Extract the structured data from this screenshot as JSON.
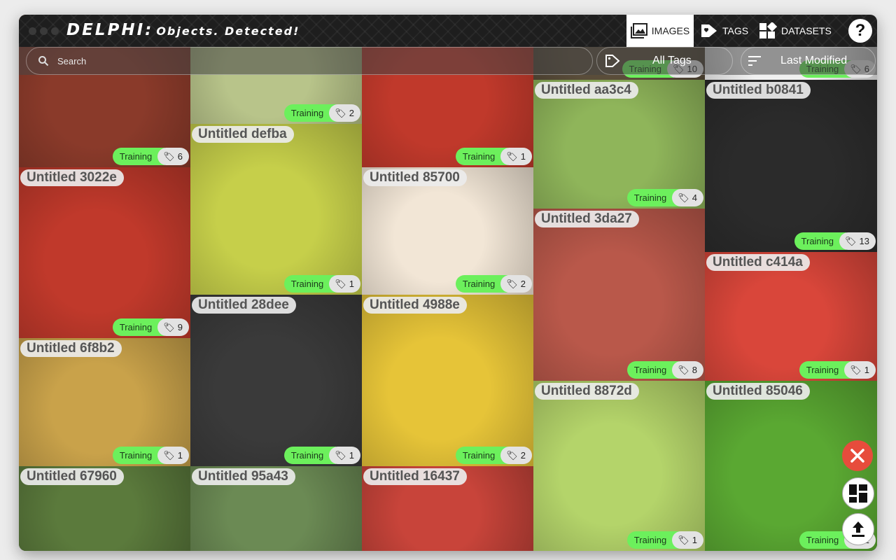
{
  "app": {
    "title_main": "DELPHI:",
    "title_tag": "Objects. Detected!"
  },
  "nav": {
    "images_label": "IMAGES",
    "tags_label": "TAGS",
    "datasets_label": "DATASETS",
    "help_label": "?"
  },
  "toolbar": {
    "search_placeholder": "Search",
    "tag_filter": "All Tags",
    "sort": "Last Modified"
  },
  "icons": {
    "search": "search-icon",
    "tag_filter": "tag-icon",
    "sort": "sort-icon",
    "images_nav": "image-icon",
    "tags_nav": "tag-icon",
    "datasets_nav": "datasets-icon",
    "close_fab": "close-icon",
    "layout_fab": "layout-icon",
    "upload_fab": "upload-icon"
  },
  "colors": {
    "accent_training": "#6cf05c",
    "close_fab": "#e74c3c",
    "header": "#1e1e1e"
  },
  "tiles": [
    {
      "title": "",
      "label": "Training",
      "count": "6",
      "bg": "#8a3a2a"
    },
    {
      "title": "",
      "label": "Training",
      "count": "2",
      "bg": "#b8c48a"
    },
    {
      "title": "",
      "label": "Training",
      "count": "1",
      "bg": "#c0392b"
    },
    {
      "title": "",
      "label": "Training",
      "count": "10",
      "bg": "#5a4d3a"
    },
    {
      "title": "",
      "label": "Training",
      "count": "6",
      "bg": "#f0f0f0"
    },
    {
      "title": "Untitled defba",
      "label": "Training",
      "count": "1",
      "bg": "#c6cf4a"
    },
    {
      "title": "Untitled 3022e",
      "label": "Training",
      "count": "9",
      "bg": "#c0392b"
    },
    {
      "title": "Untitled 85700",
      "label": "Training",
      "count": "2",
      "bg": "#f2e6d6"
    },
    {
      "title": "Untitled aa3c4",
      "label": "Training",
      "count": "4",
      "bg": "#8fb55a"
    },
    {
      "title": "Untitled b0841",
      "label": "Training",
      "count": "13",
      "bg": "#2b2b2b"
    },
    {
      "title": "Untitled 3da27",
      "label": "Training",
      "count": "8",
      "bg": "#b9584a"
    },
    {
      "title": "Untitled c414a",
      "label": "Training",
      "count": "1",
      "bg": "#d9463a"
    },
    {
      "title": "Untitled 28dee",
      "label": "Training",
      "count": "1",
      "bg": "#3a3a3a"
    },
    {
      "title": "Untitled 4988e",
      "label": "Training",
      "count": "2",
      "bg": "#e6c438"
    },
    {
      "title": "Untitled 6f8b2",
      "label": "Training",
      "count": "1",
      "bg": "#c9a24a"
    },
    {
      "title": "Untitled 8872d",
      "label": "Training",
      "count": "1",
      "bg": "#b4d46a"
    },
    {
      "title": "Untitled 85046",
      "label": "Training",
      "count": "1",
      "bg": "#5aa832"
    },
    {
      "title": "Untitled 67960",
      "label": "",
      "count": "",
      "bg": "#5b7a3c"
    },
    {
      "title": "Untitled 95a43",
      "label": "",
      "count": "",
      "bg": "#6b8a54"
    },
    {
      "title": "Untitled 16437",
      "label": "",
      "count": "",
      "bg": "#c8443a"
    }
  ]
}
